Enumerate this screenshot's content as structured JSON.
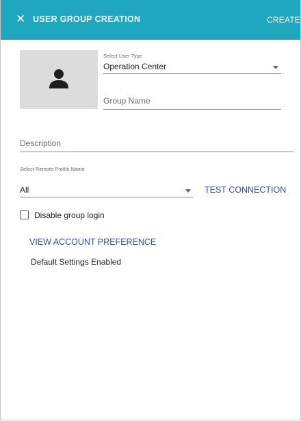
{
  "header": {
    "close_icon": "close-icon",
    "close_glyph": "✕",
    "title": "USER GROUP CREATION",
    "create_label": "CREATE",
    "color": "#1fa7c0"
  },
  "avatar": {
    "icon": "person-icon"
  },
  "user_type": {
    "label": "Select User Type",
    "value": "Operation Center"
  },
  "group_name": {
    "placeholder": "Group Name",
    "value": ""
  },
  "description": {
    "placeholder": "Description",
    "value": ""
  },
  "remote_profile": {
    "label": "Select Remote Profile Name",
    "value": "All"
  },
  "test_connection_label": "TEST CONNECTION",
  "disable_login": {
    "label": "Disable group login",
    "checked": false
  },
  "view_account_preference_label": "VIEW ACCOUNT PREFERENCE",
  "default_settings_text": "Default Settings Enabled",
  "accent_color": "#3a4fa8"
}
